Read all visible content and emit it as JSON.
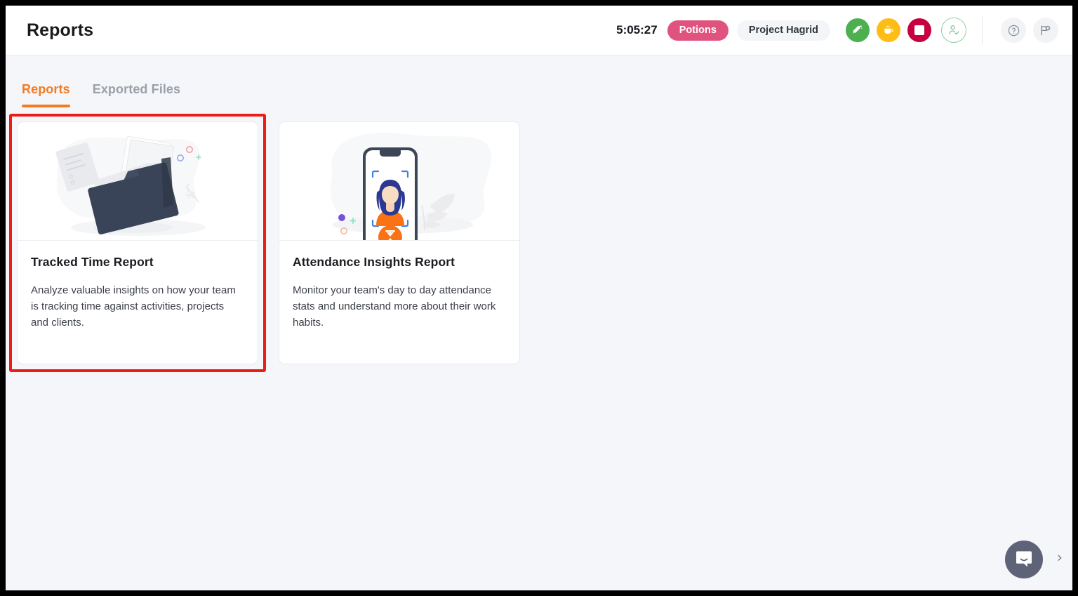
{
  "header": {
    "title": "Reports",
    "timer": "5:05:27",
    "task_chip": "Potions",
    "project_chip": "Project Hagrid",
    "buttons": {
      "switch_task": "switch-task-button",
      "take_break": "take-break-button",
      "stop_timer": "stop-timer-button",
      "check_out": "check-out-button",
      "help": "help-button",
      "settings": "settings-button"
    },
    "colors": {
      "switch_task": "#4caf50",
      "take_break": "#fcbe16",
      "stop_timer": "#c7003f",
      "check_out_border": "#8fd19e",
      "task_chip_bg": "#e0537e",
      "accent": "#f47b20"
    }
  },
  "tabs": [
    {
      "label": "Reports",
      "active": true
    },
    {
      "label": "Exported Files",
      "active": false
    }
  ],
  "cards": [
    {
      "title": "Tracked Time Report",
      "description": "Analyze valuable insights on how your team is tracking time against activities, projects and clients.",
      "illustration": "folder-documents-illustration",
      "selected": true
    },
    {
      "title": "Attendance Insights Report",
      "description": "Monitor your team's day to day attendance stats and understand more about their work habits.",
      "illustration": "phone-face-scan-illustration",
      "selected": false
    }
  ],
  "chat": {
    "launcher_icon": "chat-bubble-icon",
    "chevron": "›"
  },
  "highlight": {
    "color": "#ee1b16"
  }
}
